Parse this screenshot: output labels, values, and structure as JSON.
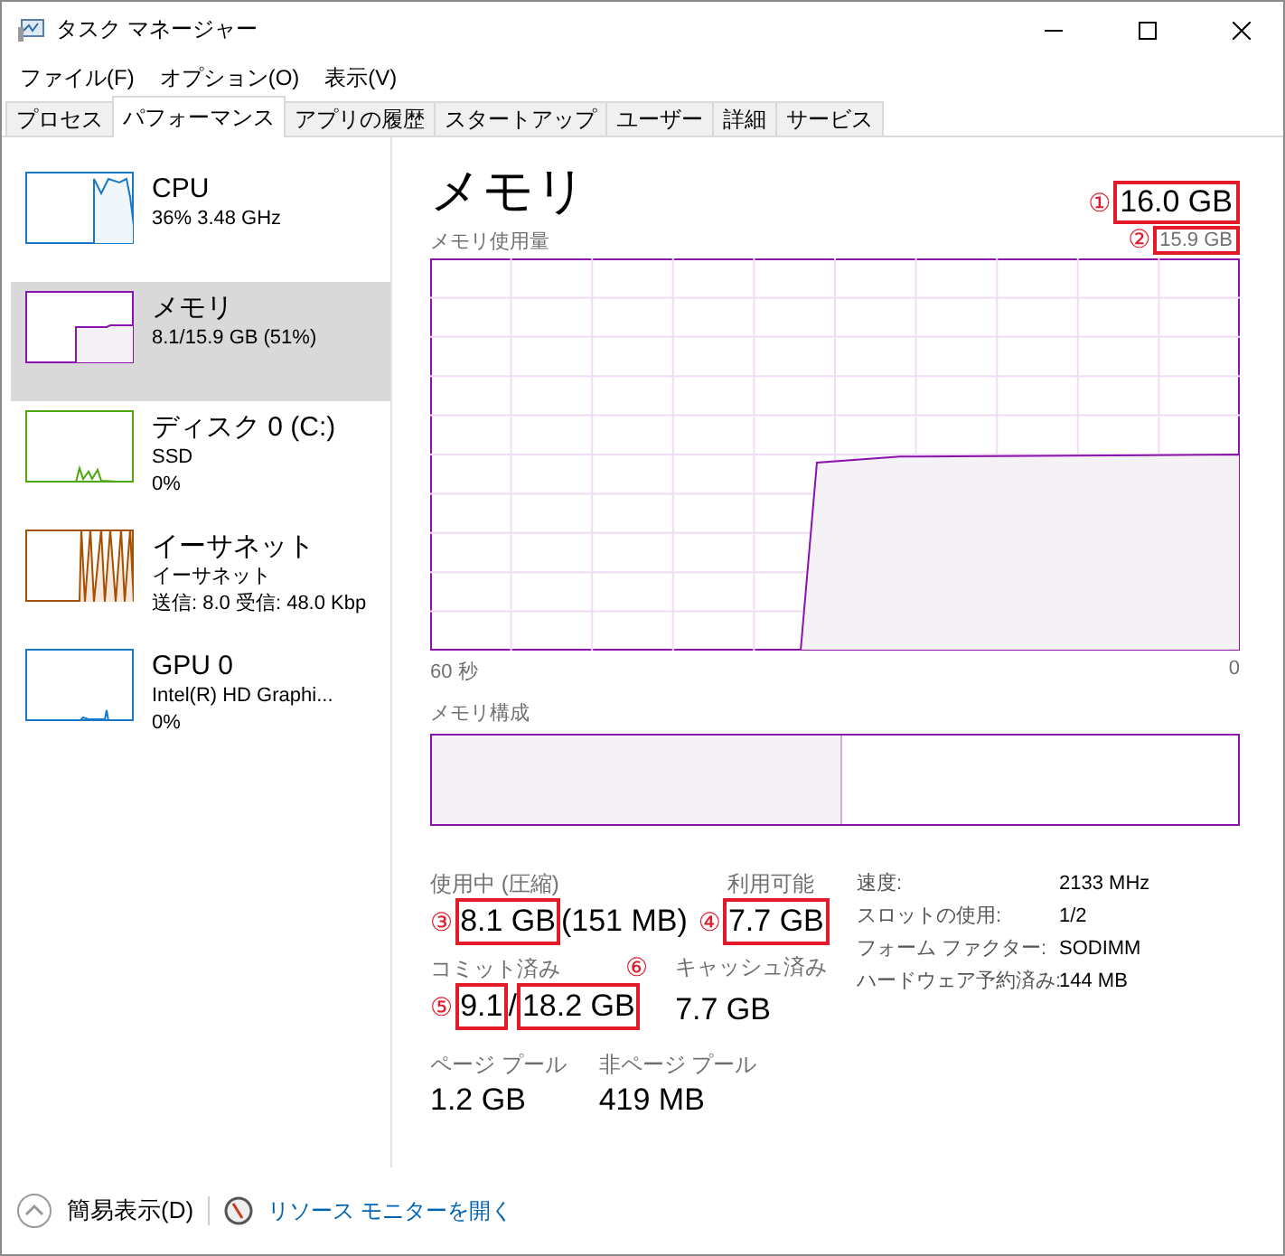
{
  "window": {
    "title": "タスク マネージャー"
  },
  "menu": [
    "ファイル(F)",
    "オプション(O)",
    "表示(V)"
  ],
  "tabs": [
    {
      "label": "プロセス",
      "selected": false
    },
    {
      "label": "パフォーマンス",
      "selected": true
    },
    {
      "label": "アプリの履歴",
      "selected": false
    },
    {
      "label": "スタートアップ",
      "selected": false
    },
    {
      "label": "ユーザー",
      "selected": false
    },
    {
      "label": "詳細",
      "selected": false
    },
    {
      "label": "サービス",
      "selected": false
    }
  ],
  "sidebar": {
    "items": [
      {
        "kind": "cpu",
        "name": "CPU",
        "lines": [
          "36%  3.48 GHz"
        ],
        "color": "#1979c8",
        "selected": false
      },
      {
        "kind": "memory",
        "name": "メモリ",
        "lines": [
          "8.1/15.9 GB (51%)"
        ],
        "color": "#8b12ae",
        "selected": true
      },
      {
        "kind": "disk",
        "name": "ディスク 0 (C:)",
        "lines": [
          "SSD",
          "0%"
        ],
        "color": "#4da60c",
        "selected": false
      },
      {
        "kind": "network",
        "name": "イーサネット",
        "lines": [
          "イーサネット",
          "送信: 8.0 受信: 48.0 Kbp"
        ],
        "color": "#a74f01",
        "selected": false
      },
      {
        "kind": "gpu",
        "name": "GPU 0",
        "lines": [
          "Intel(R) HD Graphi...",
          "0%"
        ],
        "color": "#1979c8",
        "selected": false
      }
    ]
  },
  "detail": {
    "title": "メモリ",
    "total": {
      "marker": "①",
      "text": "16.0 GB",
      "highlighted": true
    },
    "usage_label": "メモリ使用量",
    "usage_max": {
      "marker": "②",
      "text": "15.9 GB",
      "highlighted": true
    },
    "axis_start": "60 秒",
    "axis_end": "0",
    "composition_label": "メモリ構成",
    "composition": {
      "level": 0.51
    },
    "in_use": {
      "label": "使用中 (圧縮)",
      "marker": "③",
      "value": "8.1 GB",
      "highlighted": true,
      "extra": "(151 MB)"
    },
    "available": {
      "label": "利用可能",
      "marker": "④",
      "value": "7.7 GB",
      "highlighted": true
    },
    "committed": {
      "label": "コミット済み",
      "first": {
        "marker": "⑤",
        "text": "9.1",
        "highlighted": true
      },
      "separator": "/",
      "second": {
        "marker": "⑥",
        "text": "18.2 GB",
        "highlighted": true
      }
    },
    "cached": {
      "label": "キャッシュ済み",
      "value": "7.7 GB"
    },
    "paged_pool": {
      "label": "ページ プール",
      "value": "1.2 GB"
    },
    "nonpaged_pool": {
      "label": "非ページ プール",
      "value": "419 MB"
    },
    "properties": [
      {
        "label": "速度:",
        "value": "2133 MHz"
      },
      {
        "label": "スロットの使用:",
        "value": "1/2"
      },
      {
        "label": "フォーム ファクター:",
        "value": "SODIMM"
      },
      {
        "label": "ハードウェア予約済み:",
        "value": "144 MB"
      }
    ]
  },
  "footer": {
    "fewer_details": "簡易表示(D)",
    "resource_monitor": "リソース モニターを開く"
  }
}
